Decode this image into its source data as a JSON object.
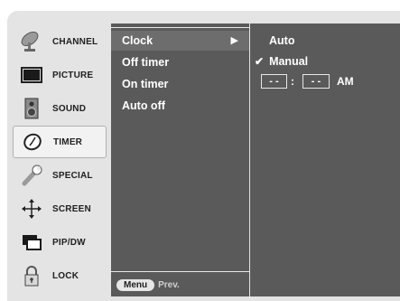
{
  "sidebar": {
    "items": [
      {
        "label": "CHANNEL",
        "icon": "satellite-dish-icon"
      },
      {
        "label": "PICTURE",
        "icon": "monitor-icon"
      },
      {
        "label": "SOUND",
        "icon": "speaker-icon"
      },
      {
        "label": "TIMER",
        "icon": "clock-icon",
        "active": true
      },
      {
        "label": "SPECIAL",
        "icon": "wrench-icon"
      },
      {
        "label": "SCREEN",
        "icon": "screen-arrows-icon"
      },
      {
        "label": "PIP/DW",
        "icon": "pip-windows-icon"
      },
      {
        "label": "LOCK",
        "icon": "padlock-icon"
      }
    ]
  },
  "timer_menu": {
    "items": [
      {
        "label": "Clock",
        "selected": true
      },
      {
        "label": "Off timer"
      },
      {
        "label": "On timer"
      },
      {
        "label": "Auto off"
      }
    ],
    "footer": {
      "menu_label": "Menu",
      "prev_label": "Prev."
    }
  },
  "clock_submenu": {
    "options": [
      {
        "label": "Auto"
      },
      {
        "label": "Manual",
        "checked": true
      }
    ],
    "hour_value": "- -",
    "minute_value": "- -",
    "separator": ":",
    "ampm": "AM"
  },
  "colors": {
    "panel": "#5a5a5a",
    "selected_row": "#6d6d6d",
    "sidebar_bg": "#e4e4e4",
    "active_item_bg": "#f2f2f2"
  }
}
